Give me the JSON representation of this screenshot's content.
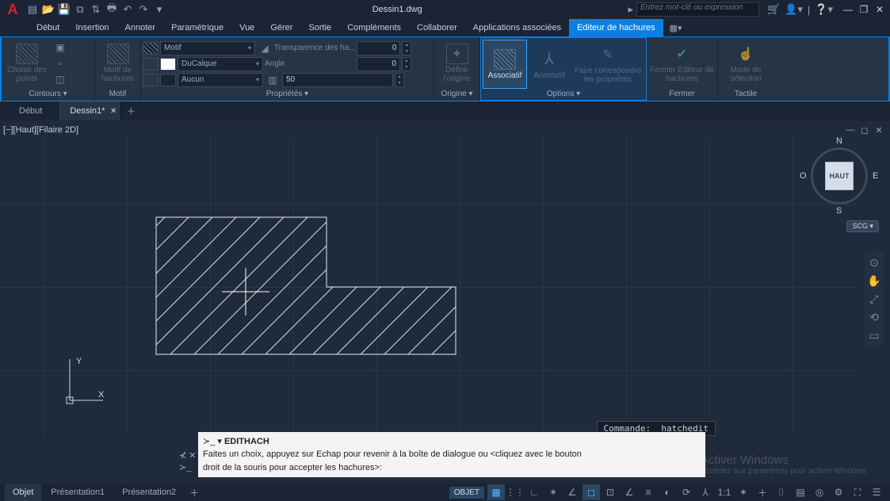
{
  "title": "Dessin1.dwg",
  "search_placeholder": "Entrez mot-clé ou expression",
  "menus": [
    "Début",
    "Insertion",
    "Annoter",
    "Paramétrique",
    "Vue",
    "Gérer",
    "Sortie",
    "Compléments",
    "Collaborer",
    "Applications associées",
    "Editeur de hachures"
  ],
  "active_menu": 10,
  "ribbon": {
    "panels": {
      "contours": {
        "title": "Contours ▾",
        "pick_points": "Choisir des points"
      },
      "motif": {
        "title": "Motif",
        "pattern": "Motif de hachures"
      },
      "props": {
        "title": "Propriétés ▾",
        "type": "Motif",
        "layer": "DuCalque",
        "none": "Aucun",
        "transparency_label": "Transparence des ha...",
        "transparency_val": "0",
        "angle_label": "Angle",
        "angle_val": "0",
        "scale_val": "50"
      },
      "origin": {
        "title": "Origine ▾",
        "define": "Définir l'origine"
      },
      "options": {
        "title": "Options ▾",
        "assoc": "Associatif",
        "annot": "Annotatif",
        "match": "Faire correspondre les propriétés"
      },
      "close": {
        "title": "Fermer",
        "btn": "Fermer Editeur de hachures"
      },
      "touch": {
        "title": "Tactile",
        "btn": "Mode de sélection"
      }
    }
  },
  "file_tabs": [
    {
      "label": "Début",
      "active": false
    },
    {
      "label": "Dessin1*",
      "active": true
    }
  ],
  "view_label": "[−][Haut][Filaire 2D]",
  "viewcube": {
    "face": "HAUT",
    "n": "N",
    "s": "S",
    "e": "E",
    "o": "O",
    "scg": "SCG ▾"
  },
  "ucs": {
    "x": "X",
    "y": "Y"
  },
  "command_history": "Commande: _hatchedit",
  "command_prompt": {
    "name": "EDITHACH",
    "text1": "Faites un choix, appuyez sur Echap pour revenir à la boîte de dialogue ou <cliquez avec le bouton",
    "text2": "droit de la souris pour accepter les hachures>:"
  },
  "watermark": {
    "line1": "Activer Windows",
    "line2": "Accédez aux paramètres pour activer Windows"
  },
  "status": {
    "tabs": [
      "Objet",
      "Présentation1",
      "Présentation2"
    ],
    "active_tab": 0,
    "label": "OBJET"
  }
}
